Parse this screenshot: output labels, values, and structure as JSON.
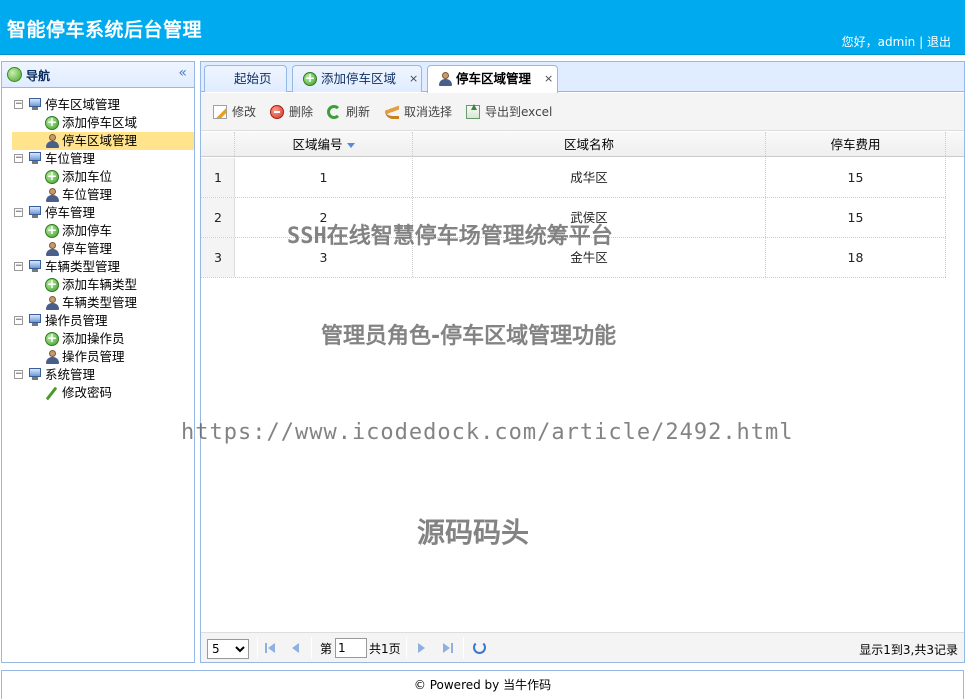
{
  "header": {
    "title": "智能停车系统后台管理",
    "greeting": "您好，admin",
    "separator": "|",
    "logout": "退出"
  },
  "nav": {
    "title": "导航",
    "collapse_glyph": "«",
    "groups": [
      {
        "label": "停车区域管理",
        "items": [
          "添加停车区域",
          "停车区域管理"
        ]
      },
      {
        "label": "车位管理",
        "items": [
          "添加车位",
          "车位管理"
        ]
      },
      {
        "label": "停车管理",
        "items": [
          "添加停车",
          "停车管理"
        ]
      },
      {
        "label": "车辆类型管理",
        "items": [
          "添加车辆类型",
          "车辆类型管理"
        ]
      },
      {
        "label": "操作员管理",
        "items": [
          "添加操作员",
          "操作员管理"
        ]
      },
      {
        "label": "系统管理",
        "items": [
          "修改密码"
        ]
      }
    ],
    "selected": "停车区域管理"
  },
  "tabs": [
    {
      "label": "起始页",
      "closable": false
    },
    {
      "label": "添加停车区域",
      "closable": true,
      "icon": "add-icon"
    },
    {
      "label": "停车区域管理",
      "closable": true,
      "icon": "user-icon",
      "active": true
    }
  ],
  "tab_close_glyph": "×",
  "toolbar": {
    "edit": "修改",
    "delete": "删除",
    "refresh": "刷新",
    "cancel_select": "取消选择",
    "export": "导出到excel"
  },
  "grid": {
    "columns": [
      "区域编号",
      "区域名称",
      "停车费用"
    ],
    "rows": [
      {
        "rownum": "1",
        "id": "1",
        "name": "成华区",
        "fee": "15"
      },
      {
        "rownum": "2",
        "id": "2",
        "name": "武侯区",
        "fee": "15"
      },
      {
        "rownum": "3",
        "id": "3",
        "name": "金牛区",
        "fee": "18"
      }
    ]
  },
  "pager": {
    "page_size": "5",
    "page_prefix": "第",
    "page_value": "1",
    "page_total": "共1页",
    "info": "显示1到3,共3记录"
  },
  "footer": "© Powered by 当牛作码",
  "watermarks": {
    "line1": "SSH在线智慧停车场管理统筹平台",
    "line2": "管理员角色-停车区域管理功能",
    "line3": "https://www.icodedock.com/article/2492.html",
    "line4": "源码码头"
  }
}
